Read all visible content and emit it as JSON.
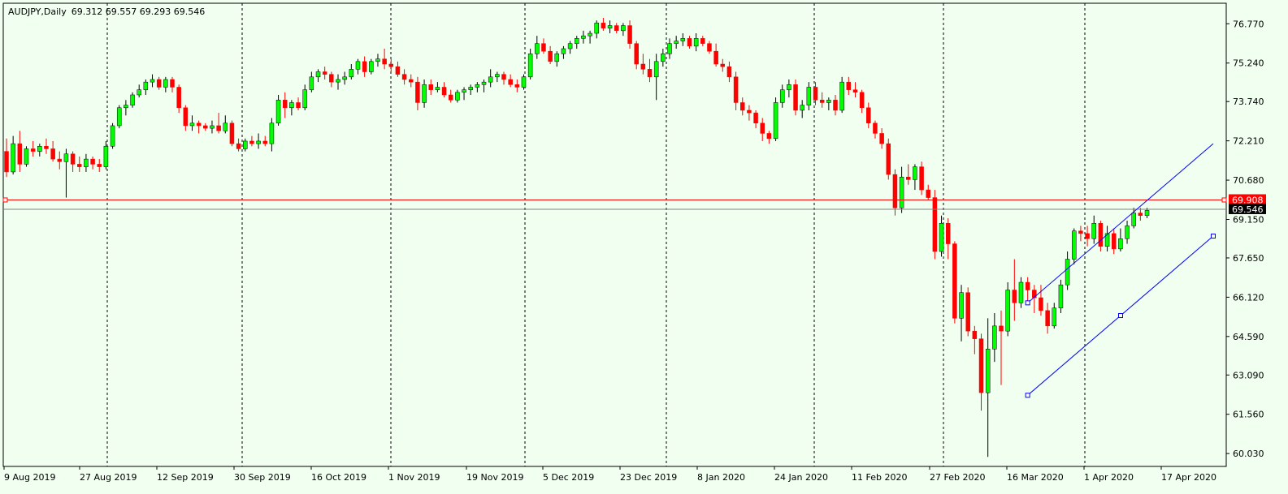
{
  "window": {
    "symbol": "AUDJPY",
    "timeframe": "Daily",
    "ohlc": "69.312 69.557 69.293 69.546"
  },
  "colors": {
    "background": "#f0fff0",
    "bull": "#00ff00",
    "bear": "#ff0000",
    "wick": "#000000",
    "grid": "#000000",
    "level_line": "#ff0000",
    "channel": "#0000ff",
    "current_price_line": "#808080"
  },
  "chart_data": {
    "type": "candlestick",
    "title": "AUDJPY,Daily",
    "y_axis_ticks": [
      "76.770",
      "75.240",
      "73.740",
      "72.210",
      "70.680",
      "69.150",
      "67.650",
      "66.120",
      "64.590",
      "63.090",
      "61.560",
      "60.030"
    ],
    "x_axis_ticks": [
      "9 Aug 2019",
      "27 Aug 2019",
      "12 Sep 2019",
      "30 Sep 2019",
      "16 Oct 2019",
      "1 Nov 2019",
      "19 Nov 2019",
      "5 Dec 2019",
      "23 Dec 2019",
      "8 Jan 2020",
      "24 Jan 2020",
      "11 Feb 2020",
      "27 Feb 2020",
      "16 Mar 2020",
      "1 Apr 2020",
      "17 Apr 2020"
    ],
    "ylim": [
      59.75,
      77.38
    ],
    "horizontal_level": {
      "value": 69.908,
      "label": "69.908"
    },
    "current_price": {
      "value": 69.546,
      "label": "69.546"
    },
    "grid": "vertical-dashed",
    "trend_channel": {
      "upper": [
        [
          "16 Mar 2020",
          65.9
        ],
        [
          "end",
          72.1
        ]
      ],
      "lower": [
        [
          "16 Mar 2020",
          62.3
        ],
        [
          "end",
          68.5
        ]
      ]
    },
    "candles": [
      [
        71.8,
        72.3,
        70.8,
        71.0
      ],
      [
        71.0,
        72.4,
        70.9,
        72.1
      ],
      [
        72.1,
        72.6,
        71.0,
        71.3
      ],
      [
        71.3,
        72.0,
        71.2,
        71.9
      ],
      [
        71.9,
        72.2,
        71.6,
        71.8
      ],
      [
        71.8,
        72.1,
        71.6,
        72.0
      ],
      [
        72.0,
        72.3,
        71.7,
        71.9
      ],
      [
        71.9,
        72.2,
        71.4,
        71.5
      ],
      [
        71.5,
        71.8,
        71.1,
        71.4
      ],
      [
        71.4,
        71.9,
        70.0,
        71.7
      ],
      [
        71.7,
        71.8,
        71.0,
        71.3
      ],
      [
        71.3,
        71.6,
        71.0,
        71.2
      ],
      [
        71.2,
        71.7,
        71.0,
        71.5
      ],
      [
        71.5,
        71.6,
        71.1,
        71.3
      ],
      [
        71.3,
        71.5,
        71.0,
        71.2
      ],
      [
        71.2,
        72.2,
        71.1,
        72.0
      ],
      [
        72.0,
        72.9,
        71.9,
        72.8
      ],
      [
        72.8,
        73.6,
        72.7,
        73.5
      ],
      [
        73.5,
        73.8,
        73.2,
        73.6
      ],
      [
        73.6,
        74.1,
        73.5,
        74.0
      ],
      [
        74.0,
        74.4,
        73.9,
        74.2
      ],
      [
        74.2,
        74.6,
        74.0,
        74.5
      ],
      [
        74.5,
        74.8,
        74.3,
        74.6
      ],
      [
        74.6,
        74.7,
        74.2,
        74.3
      ],
      [
        74.3,
        74.7,
        74.1,
        74.6
      ],
      [
        74.6,
        74.7,
        74.1,
        74.3
      ],
      [
        74.3,
        74.4,
        73.3,
        73.5
      ],
      [
        73.5,
        73.6,
        72.6,
        72.8
      ],
      [
        72.8,
        73.2,
        72.6,
        72.9
      ],
      [
        72.9,
        73.0,
        72.5,
        72.8
      ],
      [
        72.8,
        72.9,
        72.6,
        72.7
      ],
      [
        72.7,
        73.0,
        72.5,
        72.8
      ],
      [
        72.8,
        73.3,
        72.5,
        72.6
      ],
      [
        72.6,
        73.2,
        72.5,
        72.9
      ],
      [
        72.9,
        73.0,
        72.0,
        72.1
      ],
      [
        72.1,
        72.3,
        71.8,
        71.9
      ],
      [
        71.9,
        72.3,
        71.8,
        72.2
      ],
      [
        72.2,
        72.4,
        72.0,
        72.1
      ],
      [
        72.1,
        72.5,
        71.9,
        72.2
      ],
      [
        72.2,
        72.4,
        72.0,
        72.1
      ],
      [
        72.1,
        73.1,
        71.8,
        72.9
      ],
      [
        72.9,
        74.0,
        72.8,
        73.8
      ],
      [
        73.8,
        74.1,
        73.1,
        73.5
      ],
      [
        73.5,
        73.8,
        73.2,
        73.7
      ],
      [
        73.7,
        73.9,
        73.4,
        73.5
      ],
      [
        73.5,
        74.4,
        73.4,
        74.2
      ],
      [
        74.2,
        74.9,
        74.1,
        74.7
      ],
      [
        74.7,
        75.0,
        74.5,
        74.9
      ],
      [
        74.9,
        75.1,
        74.6,
        74.8
      ],
      [
        74.8,
        74.9,
        74.3,
        74.5
      ],
      [
        74.5,
        74.8,
        74.2,
        74.6
      ],
      [
        74.6,
        74.9,
        74.4,
        74.7
      ],
      [
        74.7,
        75.2,
        74.6,
        75.0
      ],
      [
        75.0,
        75.4,
        74.8,
        75.3
      ],
      [
        75.3,
        75.5,
        74.7,
        74.9
      ],
      [
        74.9,
        75.4,
        74.8,
        75.3
      ],
      [
        75.3,
        75.6,
        75.1,
        75.4
      ],
      [
        75.4,
        75.8,
        75.0,
        75.2
      ],
      [
        75.2,
        75.4,
        74.9,
        75.1
      ],
      [
        75.1,
        75.3,
        74.7,
        74.8
      ],
      [
        74.8,
        75.0,
        74.4,
        74.6
      ],
      [
        74.6,
        74.8,
        74.3,
        74.5
      ],
      [
        74.5,
        74.7,
        73.4,
        73.7
      ],
      [
        73.7,
        74.6,
        73.5,
        74.4
      ],
      [
        74.4,
        74.6,
        74.0,
        74.2
      ],
      [
        74.2,
        74.5,
        74.1,
        74.3
      ],
      [
        74.3,
        74.5,
        73.9,
        74.0
      ],
      [
        74.0,
        74.2,
        73.7,
        73.8
      ],
      [
        73.8,
        74.2,
        73.7,
        74.1
      ],
      [
        74.1,
        74.3,
        73.8,
        74.2
      ],
      [
        74.2,
        74.4,
        74.0,
        74.3
      ],
      [
        74.3,
        74.5,
        74.1,
        74.4
      ],
      [
        74.4,
        74.6,
        74.1,
        74.5
      ],
      [
        74.5,
        75.0,
        74.3,
        74.7
      ],
      [
        74.7,
        74.9,
        74.5,
        74.8
      ],
      [
        74.8,
        74.9,
        74.4,
        74.6
      ],
      [
        74.6,
        74.8,
        74.3,
        74.4
      ],
      [
        74.4,
        74.6,
        74.1,
        74.3
      ],
      [
        74.3,
        74.8,
        74.2,
        74.7
      ],
      [
        74.7,
        75.8,
        74.6,
        75.6
      ],
      [
        75.6,
        76.3,
        75.4,
        76.0
      ],
      [
        76.0,
        76.2,
        75.6,
        75.7
      ],
      [
        75.7,
        75.9,
        75.2,
        75.3
      ],
      [
        75.3,
        75.7,
        75.1,
        75.6
      ],
      [
        75.6,
        75.9,
        75.4,
        75.8
      ],
      [
        75.8,
        76.1,
        75.6,
        76.0
      ],
      [
        76.0,
        76.3,
        75.8,
        76.2
      ],
      [
        76.2,
        76.5,
        76.0,
        76.3
      ],
      [
        76.3,
        76.5,
        76.0,
        76.4
      ],
      [
        76.4,
        76.9,
        76.2,
        76.8
      ],
      [
        76.8,
        77.0,
        76.5,
        76.6
      ],
      [
        76.6,
        76.9,
        76.4,
        76.7
      ],
      [
        76.7,
        76.8,
        76.4,
        76.5
      ],
      [
        76.5,
        76.8,
        76.3,
        76.7
      ],
      [
        76.7,
        76.9,
        75.8,
        76.0
      ],
      [
        76.0,
        76.1,
        75.0,
        75.2
      ],
      [
        75.2,
        75.6,
        74.8,
        75.0
      ],
      [
        75.0,
        75.4,
        74.5,
        74.7
      ],
      [
        74.7,
        75.6,
        73.8,
        75.3
      ],
      [
        75.3,
        75.8,
        75.1,
        75.6
      ],
      [
        75.6,
        76.2,
        75.4,
        76.0
      ],
      [
        76.0,
        76.3,
        75.8,
        76.1
      ],
      [
        76.1,
        76.4,
        75.9,
        76.2
      ],
      [
        76.2,
        76.3,
        75.8,
        75.9
      ],
      [
        75.9,
        76.4,
        75.7,
        76.2
      ],
      [
        76.2,
        76.3,
        75.9,
        76.0
      ],
      [
        76.0,
        76.1,
        75.6,
        75.7
      ],
      [
        75.7,
        76.0,
        75.1,
        75.2
      ],
      [
        75.2,
        75.4,
        74.9,
        75.1
      ],
      [
        75.1,
        75.3,
        74.5,
        74.7
      ],
      [
        74.7,
        74.9,
        73.4,
        73.7
      ],
      [
        73.7,
        73.9,
        73.2,
        73.4
      ],
      [
        73.4,
        73.6,
        73.0,
        73.3
      ],
      [
        73.3,
        73.4,
        72.7,
        72.9
      ],
      [
        72.9,
        73.1,
        72.2,
        72.5
      ],
      [
        72.5,
        72.6,
        72.1,
        72.3
      ],
      [
        72.3,
        73.9,
        72.2,
        73.7
      ],
      [
        73.7,
        74.4,
        73.5,
        74.2
      ],
      [
        74.2,
        74.6,
        73.9,
        74.4
      ],
      [
        74.4,
        74.6,
        73.2,
        73.4
      ],
      [
        73.4,
        73.8,
        73.1,
        73.6
      ],
      [
        73.6,
        74.5,
        73.4,
        74.3
      ],
      [
        74.3,
        74.5,
        73.6,
        73.8
      ],
      [
        73.8,
        74.1,
        73.5,
        73.7
      ],
      [
        73.7,
        73.9,
        73.4,
        73.8
      ],
      [
        73.8,
        74.0,
        73.2,
        73.4
      ],
      [
        73.4,
        74.7,
        73.3,
        74.5
      ],
      [
        74.5,
        74.7,
        74.0,
        74.2
      ],
      [
        74.2,
        74.5,
        73.9,
        74.1
      ],
      [
        74.1,
        74.2,
        73.3,
        73.5
      ],
      [
        73.5,
        73.7,
        72.7,
        72.9
      ],
      [
        72.9,
        73.0,
        72.3,
        72.5
      ],
      [
        72.5,
        72.7,
        71.9,
        72.1
      ],
      [
        72.1,
        72.3,
        70.7,
        70.9
      ],
      [
        70.9,
        71.1,
        69.3,
        69.6
      ],
      [
        69.6,
        71.2,
        69.4,
        70.8
      ],
      [
        70.8,
        71.3,
        70.5,
        70.7
      ],
      [
        70.7,
        71.3,
        70.3,
        71.2
      ],
      [
        71.2,
        71.4,
        70.1,
        70.3
      ],
      [
        70.3,
        70.5,
        69.9,
        70.0
      ],
      [
        70.0,
        70.3,
        67.6,
        67.9
      ],
      [
        67.9,
        69.3,
        67.7,
        69.0
      ],
      [
        69.0,
        69.2,
        67.6,
        68.2
      ],
      [
        68.2,
        68.3,
        65.1,
        65.3
      ],
      [
        65.3,
        66.6,
        64.4,
        66.3
      ],
      [
        66.3,
        66.5,
        64.6,
        64.8
      ],
      [
        64.8,
        65.0,
        63.9,
        64.5
      ],
      [
        64.5,
        64.7,
        61.7,
        62.4
      ],
      [
        62.4,
        65.3,
        59.9,
        64.1
      ],
      [
        64.1,
        65.5,
        63.6,
        65.0
      ],
      [
        65.0,
        65.6,
        62.7,
        64.8
      ],
      [
        64.8,
        66.7,
        64.6,
        66.4
      ],
      [
        66.4,
        67.6,
        65.2,
        65.9
      ],
      [
        65.9,
        66.9,
        65.7,
        66.7
      ],
      [
        66.7,
        66.9,
        65.9,
        66.4
      ],
      [
        66.4,
        66.6,
        65.5,
        66.1
      ],
      [
        66.1,
        66.6,
        65.4,
        65.6
      ],
      [
        65.6,
        65.9,
        64.7,
        65.0
      ],
      [
        65.0,
        65.9,
        64.9,
        65.7
      ],
      [
        65.7,
        66.8,
        65.5,
        66.6
      ],
      [
        66.6,
        67.9,
        66.4,
        67.6
      ],
      [
        67.6,
        68.8,
        67.4,
        68.7
      ],
      [
        68.7,
        68.9,
        68.3,
        68.6
      ],
      [
        68.6,
        68.9,
        68.1,
        68.4
      ],
      [
        68.4,
        69.3,
        68.2,
        69.0
      ],
      [
        69.0,
        69.1,
        67.9,
        68.1
      ],
      [
        68.1,
        68.9,
        67.9,
        68.6
      ],
      [
        68.6,
        68.8,
        67.8,
        68.0
      ],
      [
        68.0,
        68.8,
        67.9,
        68.4
      ],
      [
        68.4,
        69.1,
        68.2,
        68.9
      ],
      [
        68.9,
        69.6,
        68.8,
        69.4
      ],
      [
        69.4,
        69.6,
        69.1,
        69.3
      ],
      [
        69.3,
        69.6,
        69.2,
        69.5
      ]
    ]
  }
}
